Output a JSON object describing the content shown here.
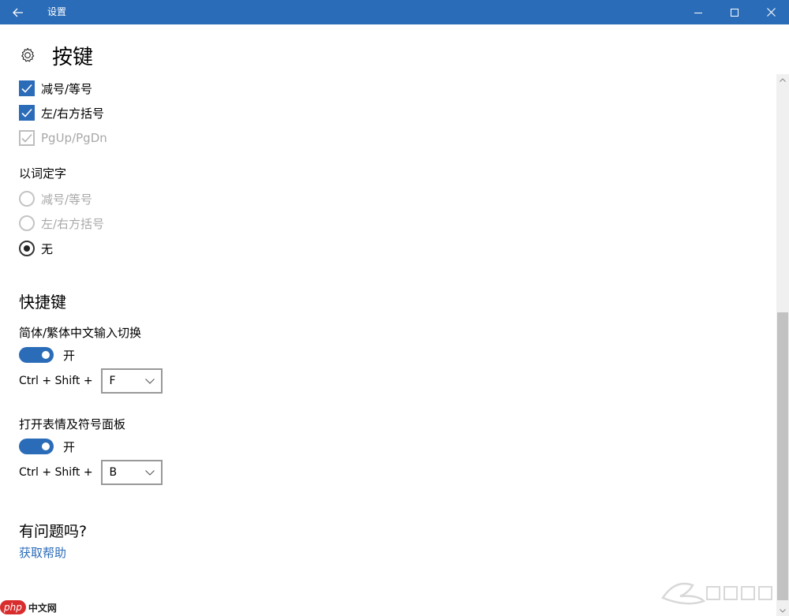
{
  "titlebar": {
    "title": "设置"
  },
  "page": {
    "title": "按键"
  },
  "checkboxes": [
    {
      "label": "减号/等号",
      "checked": true,
      "enabled": true
    },
    {
      "label": "左/右方括号",
      "checked": true,
      "enabled": true
    },
    {
      "label": "PgUp/PgDn",
      "checked": true,
      "enabled": false
    }
  ],
  "word_select": {
    "label": "以词定字",
    "options": [
      {
        "label": "减号/等号",
        "selected": false,
        "enabled": false
      },
      {
        "label": "左/右方括号",
        "selected": false,
        "enabled": false
      },
      {
        "label": "无",
        "selected": true,
        "enabled": true
      }
    ]
  },
  "shortcuts": {
    "title": "快捷键",
    "items": [
      {
        "label": "简体/繁体中文输入切换",
        "toggle_state": "开",
        "keys_prefix": "Ctrl + Shift +",
        "key": "F"
      },
      {
        "label": "打开表情及符号面板",
        "toggle_state": "开",
        "keys_prefix": "Ctrl + Shift +",
        "key": "B"
      }
    ]
  },
  "help": {
    "title": "有问题吗?",
    "link": "获取帮助"
  },
  "watermark": {
    "left_badge": "php",
    "left_text": "中文网"
  },
  "colors": {
    "accent": "#2b6cb8",
    "titlebar": "#2b6cb8"
  },
  "icons": [
    "back-arrow-icon",
    "minimize-icon",
    "maximize-icon",
    "close-icon",
    "gear-icon",
    "checkmark-icon",
    "chevron-down-icon"
  ]
}
